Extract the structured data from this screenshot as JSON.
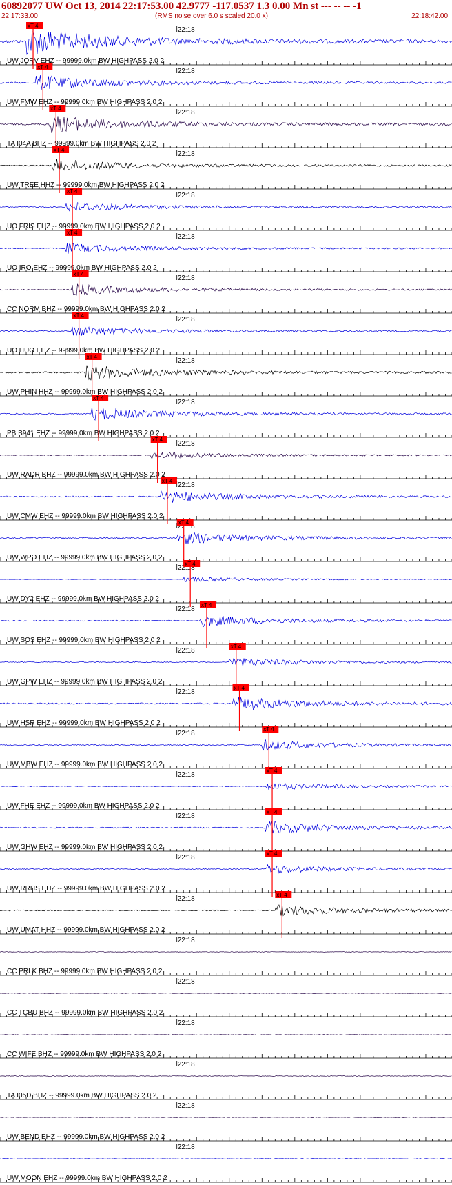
{
  "header": {
    "title": "60892077 UW Oct 13, 2014 22:17:53.00   42.9777 -117.0537  1.3 0.00 Mn st --- -- --   -1",
    "start_time": "22:17:33.00",
    "noise_note": "(RMS noise over 6.0 s scaled 20.0 x)",
    "end_time": "22:18:42.00"
  },
  "colors": {
    "header_text": "#b00000",
    "trace_blue": "#0000dd",
    "trace_dark": "#220044",
    "trace_black": "#000000",
    "pick": "#ff0000",
    "baseline": "#000000"
  },
  "chart_data": {
    "type": "seismogram",
    "time_start_s": 0,
    "time_end_s": 69,
    "minute_tick_label": "22:18",
    "minute_tick_time_s": 27,
    "pick_label": "xT 4",
    "traces": [
      {
        "label": "UW JORV EHZ -- 99999.0km BW  HIGHPASS  2.0  2",
        "color": "blue",
        "pick_s": 4.0,
        "amp": 0.55
      },
      {
        "label": "UW FMW EHZ -- 99999.0km BW  HIGHPASS  2.0  2",
        "color": "blue",
        "pick_s": 5.5,
        "amp": 0.3
      },
      {
        "label": "TA I04A BHZ -- 99999.0km BW  HIGHPASS  2.0  2",
        "color": "dark",
        "pick_s": 7.5,
        "amp": 0.35
      },
      {
        "label": "UW TREE HHZ -- 99999.0km BW  HIGHPASS  2.0  2",
        "color": "black",
        "pick_s": 8.0,
        "amp": 0.25
      },
      {
        "label": "UO FRIS EHZ -- 99999.0km BW  HIGHPASS  2.0  2",
        "color": "blue",
        "pick_s": 10.0,
        "amp": 0.2
      },
      {
        "label": "UO IRO EHZ -- 99999.0km BW  HIGHPASS  2.0  2",
        "color": "blue",
        "pick_s": 10.0,
        "amp": 0.2
      },
      {
        "label": "CC NORM BHZ -- 99999.0km BW  HIGHPASS  2.0  2",
        "color": "dark",
        "pick_s": 11.0,
        "amp": 0.22
      },
      {
        "label": "UO HUO EHZ -- 99999.0km BW  HIGHPASS  2.0  2",
        "color": "blue",
        "pick_s": 11.0,
        "amp": 0.2
      },
      {
        "label": "UW PHIN HHZ -- 99999.0km BW  HIGHPASS  2.0  2",
        "color": "black",
        "pick_s": 13.0,
        "amp": 0.3
      },
      {
        "label": "PB B941 EHZ -- 99999.0km BW  HIGHPASS  2.0  2",
        "color": "blue",
        "pick_s": 14.0,
        "amp": 0.25
      },
      {
        "label": "UW RADR BHZ -- 99999.0km BW  HIGHPASS  2.0  2",
        "color": "dark",
        "pick_s": 23.0,
        "amp": 0.15
      },
      {
        "label": "UW CMW EHZ -- 99999.0km BW  HIGHPASS  2.0  2",
        "color": "blue",
        "pick_s": 24.5,
        "amp": 0.25
      },
      {
        "label": "UW WPO EHZ -- 99999.0km BW  HIGHPASS  2.0  2",
        "color": "blue",
        "pick_s": 27.0,
        "amp": 0.25
      },
      {
        "label": "UW DY2 EHZ -- 99999.0km BW  HIGHPASS  2.0  2",
        "color": "blue",
        "pick_s": 28.0,
        "amp": 0.1
      },
      {
        "label": "UW SOS EHZ -- 99999.0km BW  HIGHPASS  2.0  2",
        "color": "blue",
        "pick_s": 30.5,
        "amp": 0.22
      },
      {
        "label": "UW GPW EHZ -- 99999.0km BW  HIGHPASS  2.0  2",
        "color": "blue",
        "pick_s": 35.0,
        "amp": 0.18
      },
      {
        "label": "UW HSR EHZ -- 99999.0km BW  HIGHPASS  2.0  2",
        "color": "blue",
        "pick_s": 35.5,
        "amp": 0.28
      },
      {
        "label": "UW MBW EHZ -- 99999.0km BW  HIGHPASS  2.0  2",
        "color": "blue",
        "pick_s": 40.0,
        "amp": 0.2
      },
      {
        "label": "UW FHE EHZ -- 99999.0km BW  HIGHPASS  2.0  2",
        "color": "blue",
        "pick_s": 40.5,
        "amp": 0.15
      },
      {
        "label": "UW GHW EHZ -- 99999.0km BW  HIGHPASS  2.0  2",
        "color": "blue",
        "pick_s": 40.5,
        "amp": 0.25
      },
      {
        "label": "UW RRHS EHZ -- 99999.0km BW  HIGHPASS  2.0  2",
        "color": "blue",
        "pick_s": 40.5,
        "amp": 0.18
      },
      {
        "label": "UW UMAT HHZ -- 99999.0km BW  HIGHPASS  2.0  2",
        "color": "black",
        "pick_s": 42.0,
        "amp": 0.22
      },
      {
        "label": "CC PRLK BHZ -- 99999.0km BW  HIGHPASS  2.0  2",
        "color": "dark",
        "pick_s": null,
        "amp": 0.12
      },
      {
        "label": "CC TCBU BHZ -- 99999.0km BW  HIGHPASS  2.0  2",
        "color": "dark",
        "pick_s": null,
        "amp": 0.12
      },
      {
        "label": "CC WIFE BHZ -- 99999.0km BW  HIGHPASS  2.0  2",
        "color": "dark",
        "pick_s": null,
        "amp": 0.12
      },
      {
        "label": "TA I05D BHZ -- 99999.0km BW  HIGHPASS  2.0  2",
        "color": "dark",
        "pick_s": null,
        "amp": 0.12
      },
      {
        "label": "UW BEND EHZ -- 99999.0km BW  HIGHPASS  2.0  2",
        "color": "dark",
        "pick_s": null,
        "amp": 0.12
      },
      {
        "label": "UW MOON EHZ -- 99999.0km BW  HIGHPASS  2.0  2",
        "color": "blue",
        "pick_s": null,
        "amp": 0.12
      }
    ]
  }
}
